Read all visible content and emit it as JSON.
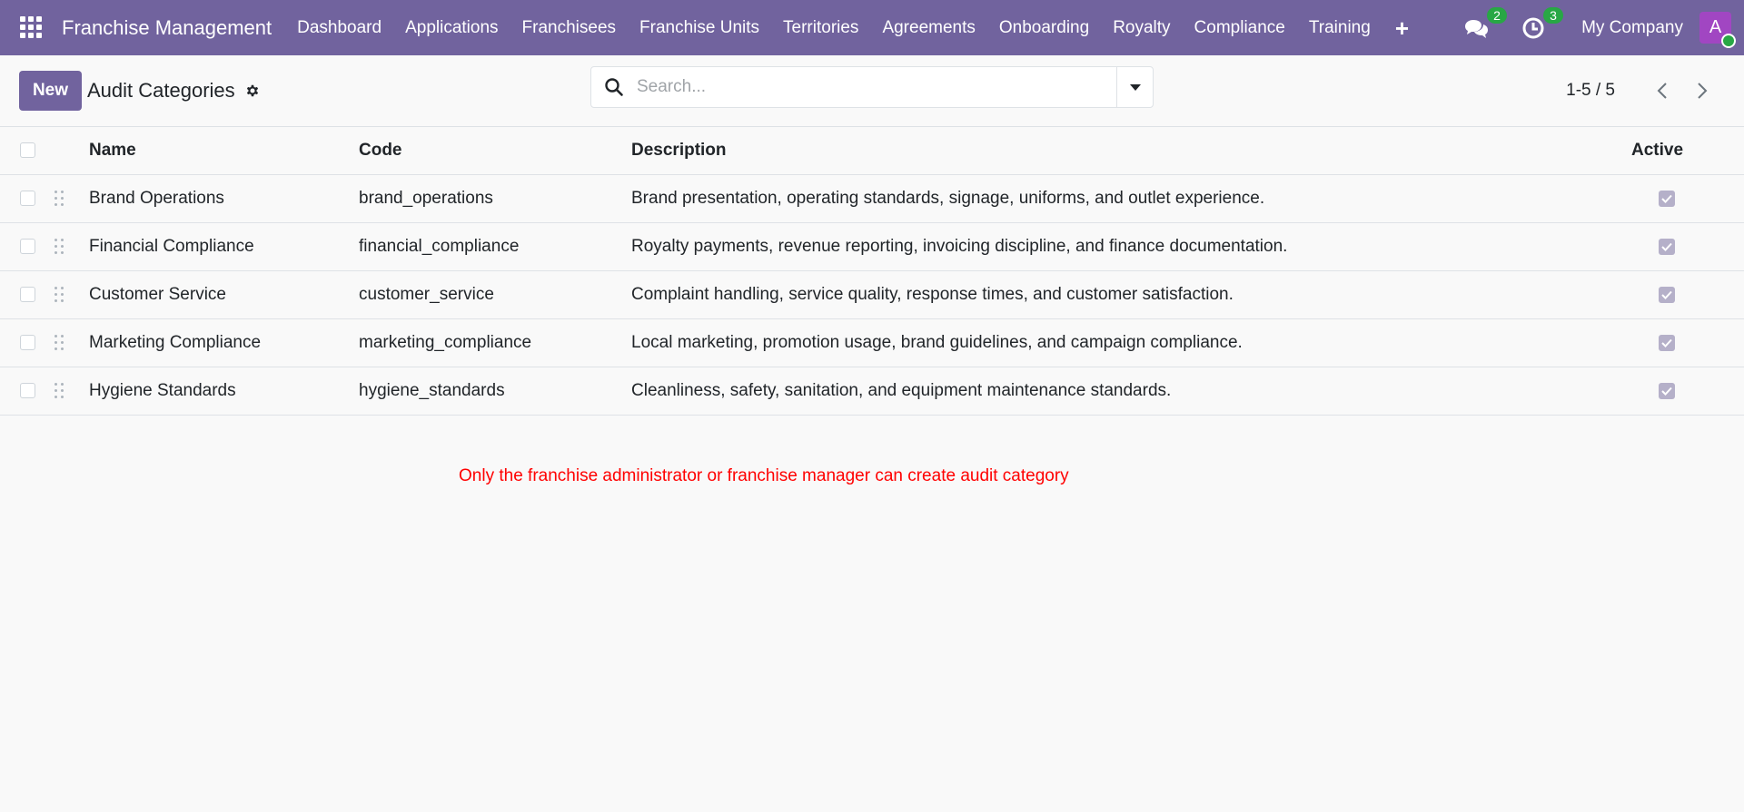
{
  "app": {
    "name": "Franchise Management",
    "menu": [
      "Dashboard",
      "Applications",
      "Franchisees",
      "Franchise Units",
      "Territories",
      "Agreements",
      "Onboarding",
      "Royalty",
      "Compliance",
      "Training"
    ],
    "messages_count": "2",
    "activities_count": "3",
    "company": "My Company",
    "user_initial": "A"
  },
  "control": {
    "new_label": "New",
    "title": "Audit Categories",
    "search_placeholder": "Search...",
    "pager": "1-5 / 5"
  },
  "table": {
    "headers": {
      "name": "Name",
      "code": "Code",
      "description": "Description",
      "active": "Active"
    },
    "rows": [
      {
        "name": "Brand Operations",
        "code": "brand_operations",
        "description": "Brand presentation, operating standards, signage, uniforms, and outlet experience.",
        "active": true
      },
      {
        "name": "Financial Compliance",
        "code": "financial_compliance",
        "description": "Royalty payments, revenue reporting, invoicing discipline, and finance documentation.",
        "active": true
      },
      {
        "name": "Customer Service",
        "code": "customer_service",
        "description": "Complaint handling, service quality, response times, and customer satisfaction.",
        "active": true
      },
      {
        "name": "Marketing Compliance",
        "code": "marketing_compliance",
        "description": "Local marketing, promotion usage, brand guidelines, and campaign compliance.",
        "active": true
      },
      {
        "name": "Hygiene Standards",
        "code": "hygiene_standards",
        "description": "Cleanliness, safety, sanitation, and equipment maintenance standards.",
        "active": true
      }
    ]
  },
  "notice": "Only the franchise administrator or franchise manager can create audit category",
  "colors": {
    "navbar": "#71639e",
    "primary": "#71639e",
    "badge": "#28a745",
    "avatar": "#a146c2",
    "notice": "#ff0000"
  }
}
